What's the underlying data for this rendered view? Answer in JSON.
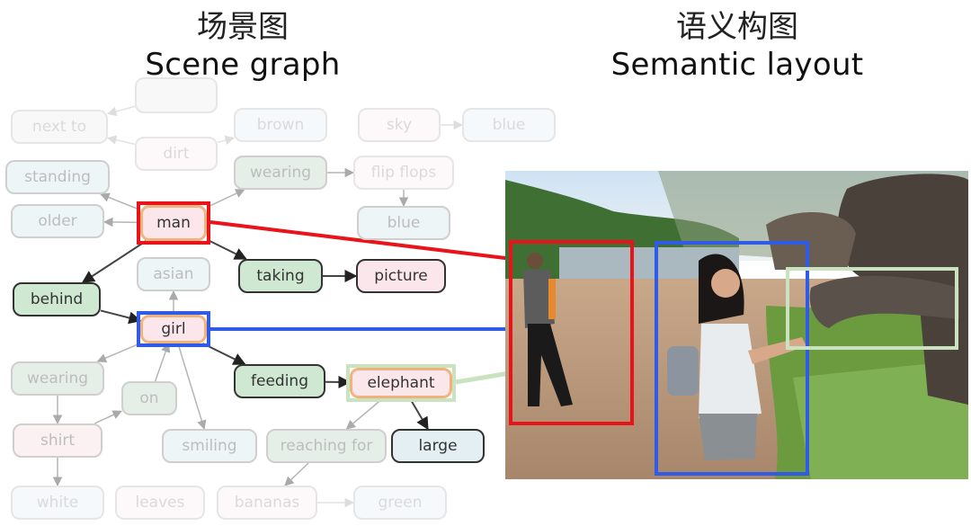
{
  "titles": {
    "left_cn": "场景图",
    "left_en": "Scene graph",
    "right_cn": "语义构图",
    "right_en": "Semantic layout"
  },
  "colors": {
    "man_highlight": "#e8141a",
    "girl_highlight": "#2f5be6",
    "elephant_highlight": "#c9e3c0"
  },
  "scene_graph": {
    "nodes": [
      {
        "id": "next_to",
        "label": "next to",
        "type": "plain",
        "emphasis": "very-faint"
      },
      {
        "id": "top_hidden",
        "label": "",
        "type": "plain",
        "emphasis": "very-faint"
      },
      {
        "id": "dirt",
        "label": "dirt",
        "type": "object",
        "emphasis": "very-faint"
      },
      {
        "id": "brown",
        "label": "brown",
        "type": "attribute",
        "emphasis": "very-faint"
      },
      {
        "id": "sky",
        "label": "sky",
        "type": "object",
        "emphasis": "very-faint"
      },
      {
        "id": "blue_sky",
        "label": "blue",
        "type": "attribute",
        "emphasis": "very-faint"
      },
      {
        "id": "standing",
        "label": "standing",
        "type": "attribute",
        "emphasis": "faint"
      },
      {
        "id": "wearing_man",
        "label": "wearing",
        "type": "relation",
        "emphasis": "faint"
      },
      {
        "id": "flip_flops",
        "label": "flip flops",
        "type": "object",
        "emphasis": "very-faint"
      },
      {
        "id": "older",
        "label": "older",
        "type": "attribute",
        "emphasis": "faint"
      },
      {
        "id": "man",
        "label": "man",
        "type": "object",
        "emphasis": "strong"
      },
      {
        "id": "blue_ff",
        "label": "blue",
        "type": "attribute",
        "emphasis": "faint"
      },
      {
        "id": "asian",
        "label": "asian",
        "type": "attribute",
        "emphasis": "faint"
      },
      {
        "id": "taking",
        "label": "taking",
        "type": "relation",
        "emphasis": "strong"
      },
      {
        "id": "picture",
        "label": "picture",
        "type": "object",
        "emphasis": "strong"
      },
      {
        "id": "behind",
        "label": "behind",
        "type": "relation",
        "emphasis": "strong"
      },
      {
        "id": "girl",
        "label": "girl",
        "type": "object",
        "emphasis": "strong"
      },
      {
        "id": "wearing_girl",
        "label": "wearing",
        "type": "relation",
        "emphasis": "faint"
      },
      {
        "id": "feeding",
        "label": "feeding",
        "type": "relation",
        "emphasis": "strong"
      },
      {
        "id": "elephant",
        "label": "elephant",
        "type": "object",
        "emphasis": "strong"
      },
      {
        "id": "on",
        "label": "on",
        "type": "relation",
        "emphasis": "faint"
      },
      {
        "id": "shirt",
        "label": "shirt",
        "type": "object",
        "emphasis": "faint"
      },
      {
        "id": "smiling",
        "label": "smiling",
        "type": "attribute",
        "emphasis": "faint"
      },
      {
        "id": "reaching_for",
        "label": "reaching for",
        "type": "relation",
        "emphasis": "faint"
      },
      {
        "id": "large",
        "label": "large",
        "type": "attribute",
        "emphasis": "strong"
      },
      {
        "id": "white",
        "label": "white",
        "type": "attribute",
        "emphasis": "very-faint"
      },
      {
        "id": "leaves",
        "label": "leaves",
        "type": "object",
        "emphasis": "very-faint"
      },
      {
        "id": "bananas",
        "label": "bananas",
        "type": "object",
        "emphasis": "very-faint"
      },
      {
        "id": "green",
        "label": "green",
        "type": "attribute",
        "emphasis": "very-faint"
      }
    ],
    "edges": [
      {
        "from": "dirt",
        "to": "next_to",
        "emphasis": "very-faint"
      },
      {
        "from": "top_hidden",
        "to": "next_to",
        "emphasis": "very-faint"
      },
      {
        "from": "dirt",
        "to": "brown",
        "emphasis": "very-faint"
      },
      {
        "from": "sky",
        "to": "blue_sky",
        "emphasis": "very-faint"
      },
      {
        "from": "man",
        "to": "standing",
        "emphasis": "faint"
      },
      {
        "from": "man",
        "to": "older",
        "emphasis": "faint"
      },
      {
        "from": "man",
        "to": "wearing_man",
        "emphasis": "faint"
      },
      {
        "from": "wearing_man",
        "to": "flip_flops",
        "emphasis": "faint"
      },
      {
        "from": "flip_flops",
        "to": "blue_ff",
        "emphasis": "faint"
      },
      {
        "from": "man",
        "to": "taking",
        "emphasis": "strong"
      },
      {
        "from": "taking",
        "to": "picture",
        "emphasis": "strong"
      },
      {
        "from": "man",
        "to": "behind",
        "emphasis": "strong"
      },
      {
        "from": "behind",
        "to": "girl",
        "emphasis": "strong"
      },
      {
        "from": "girl",
        "to": "asian",
        "emphasis": "faint"
      },
      {
        "from": "girl",
        "to": "feeding",
        "emphasis": "strong"
      },
      {
        "from": "feeding",
        "to": "elephant",
        "emphasis": "strong"
      },
      {
        "from": "girl",
        "to": "wearing_girl",
        "emphasis": "faint"
      },
      {
        "from": "wearing_girl",
        "to": "shirt",
        "emphasis": "faint"
      },
      {
        "from": "shirt",
        "to": "on",
        "emphasis": "faint"
      },
      {
        "from": "on",
        "to": "girl",
        "emphasis": "faint"
      },
      {
        "from": "girl",
        "to": "smiling",
        "emphasis": "faint"
      },
      {
        "from": "shirt",
        "to": "white",
        "emphasis": "faint"
      },
      {
        "from": "elephant",
        "to": "reaching_for",
        "emphasis": "faint"
      },
      {
        "from": "elephant",
        "to": "large",
        "emphasis": "strong"
      },
      {
        "from": "reaching_for",
        "to": "bananas",
        "emphasis": "faint"
      },
      {
        "from": "bananas",
        "to": "green",
        "emphasis": "very-faint"
      }
    ]
  },
  "semantic_layout": {
    "image_description": "Photo of a man taking a picture, a girl feeding an elephant by a river",
    "boxes": [
      {
        "object": "man",
        "color": "#e8141a"
      },
      {
        "object": "girl",
        "color": "#2f5be6"
      },
      {
        "object": "elephant",
        "color": "#c9e3c0"
      }
    ]
  }
}
